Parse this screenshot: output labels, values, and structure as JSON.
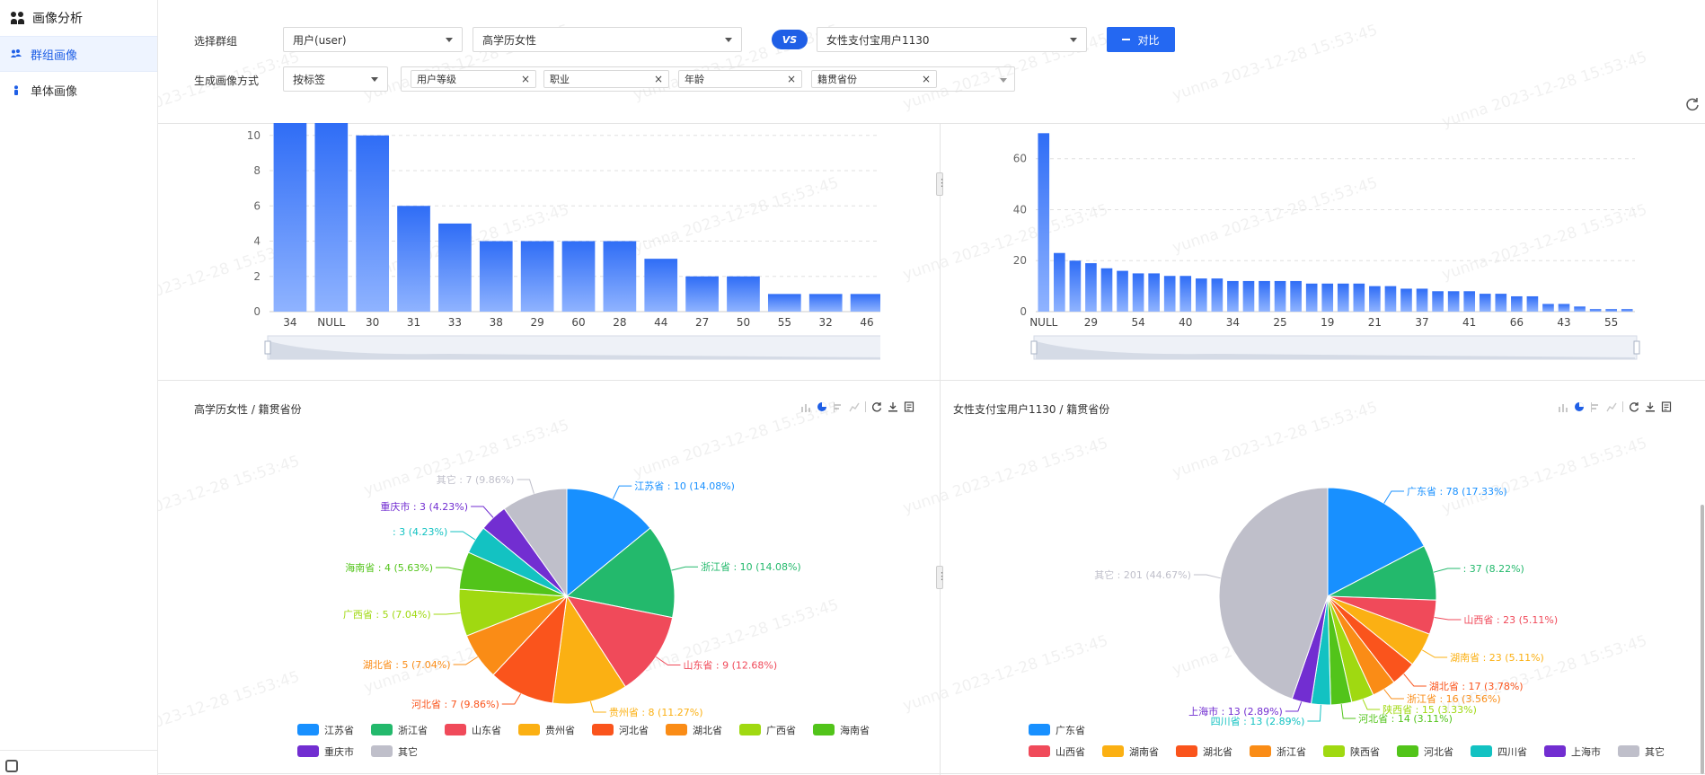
{
  "sidebar": {
    "title": "画像分析",
    "items": [
      {
        "label": "群组画像",
        "active": true
      },
      {
        "label": "单体画像",
        "active": false
      }
    ]
  },
  "controls": {
    "group_label": "选择群组",
    "group_type": "用户(user)",
    "group_a": "高学历女性",
    "vs": "VS",
    "group_b": "女性支付宝用户1130",
    "compare_button": "对比",
    "method_label": "生成画像方式",
    "method": "按标签",
    "tags": [
      "用户等级",
      "职业",
      "年龄",
      "籍贯省份"
    ]
  },
  "watermark": "yunna 2023-12-28 15:53:45",
  "colors": {
    "accent": "#2468f2",
    "bar_top": "#2f6df6",
    "bar_bottom": "#8fb3ff"
  },
  "chart_data": [
    {
      "type": "bar",
      "categories": [
        "34",
        "NULL",
        "30",
        "31",
        "33",
        "38",
        "29",
        "60",
        "28",
        "44",
        "27",
        "50",
        "55",
        "32",
        "46"
      ],
      "values": [
        11,
        11,
        10,
        6,
        5,
        4,
        4,
        4,
        4,
        3,
        2,
        2,
        1,
        1,
        1
      ],
      "yticks": [
        "0",
        "2",
        "4",
        "6",
        "8",
        "10"
      ],
      "ylim": [
        0,
        10.5
      ],
      "grid": true
    },
    {
      "type": "bar",
      "tick_labels": [
        "NULL",
        "29",
        "54",
        "40",
        "34",
        "25",
        "19",
        "21",
        "37",
        "41",
        "66",
        "43",
        "55"
      ],
      "tick_index": [
        0,
        3,
        6,
        9,
        12,
        15,
        18,
        21,
        24,
        27,
        30,
        33,
        36
      ],
      "values": [
        70,
        23,
        20,
        19,
        17,
        16,
        15,
        15,
        14,
        14,
        13,
        13,
        12,
        12,
        12,
        12,
        12,
        11,
        11,
        11,
        11,
        10,
        10,
        9,
        9,
        8,
        8,
        8,
        7,
        7,
        6,
        6,
        3,
        3,
        2,
        1,
        1,
        1
      ],
      "yticks": [
        "0",
        "20",
        "40",
        "60"
      ],
      "ylim": [
        0,
        68
      ],
      "grid": true
    },
    {
      "type": "pie",
      "title": "高学历女性 / 籍贯省份",
      "slices": [
        {
          "name": "江苏省",
          "value": 10,
          "pct": "14.08%",
          "color": "#1890ff",
          "label": "江苏省 : 10 (14.08%)"
        },
        {
          "name": "浙江省",
          "value": 10,
          "pct": "14.08%",
          "color": "#23b96c",
          "label": "浙江省 : 10 (14.08%)"
        },
        {
          "name": "山东省",
          "value": 9,
          "pct": "12.68%",
          "color": "#f04a5a",
          "label": "山东省 : 9 (12.68%)"
        },
        {
          "name": "贵州省",
          "value": 8,
          "pct": "11.27%",
          "color": "#fbb013",
          "label": "贵州省 : 8 (11.27%)"
        },
        {
          "name": "河北省",
          "value": 7,
          "pct": "9.86%",
          "color": "#fa541c",
          "label": "河北省 : 7 (9.86%)"
        },
        {
          "name": "湖北省",
          "value": 5,
          "pct": "7.04%",
          "color": "#fa8c16",
          "label": "湖北省 : 5 (7.04%)"
        },
        {
          "name": "广西省",
          "value": 5,
          "pct": "7.04%",
          "color": "#a0d911",
          "label": "广西省 : 5 (7.04%)"
        },
        {
          "name": "海南省",
          "value": 4,
          "pct": "5.63%",
          "color": "#52c41a",
          "label": "海南省 : 4 (5.63%)"
        },
        {
          "name": "",
          "value": 3,
          "pct": "4.23%",
          "color": "#13c2c2",
          "label": " : 3 (4.23%)"
        },
        {
          "name": "重庆市",
          "value": 3,
          "pct": "4.23%",
          "color": "#722ed1",
          "label": "重庆市 : 3 (4.23%)"
        },
        {
          "name": "其它",
          "value": 7,
          "pct": "9.86%",
          "color": "#bfbfca",
          "label": "其它 : 7 (9.86%)"
        }
      ],
      "legend": [
        "江苏省",
        "浙江省",
        "山东省",
        "贵州省",
        "河北省",
        "湖北省",
        "广西省",
        "海南省",
        "重庆市",
        "其它"
      ],
      "legend_position": "bottom"
    },
    {
      "type": "pie",
      "title": "女性支付宝用户1130 / 籍贯省份",
      "slices": [
        {
          "name": "广东省",
          "value": 78,
          "pct": "17.33%",
          "color": "#1890ff",
          "label": "广东省 : 78 (17.33%)"
        },
        {
          "name": "",
          "value": 37,
          "pct": "8.22%",
          "color": "#23b96c",
          "label": " : 37 (8.22%)"
        },
        {
          "name": "山西省",
          "value": 23,
          "pct": "5.11%",
          "color": "#f04a5a",
          "label": "山西省 : 23 (5.11%)"
        },
        {
          "name": "湖南省",
          "value": 23,
          "pct": "5.11%",
          "color": "#fbb013",
          "label": "湖南省 : 23 (5.11%)"
        },
        {
          "name": "湖北省",
          "value": 17,
          "pct": "3.78%",
          "color": "#fa541c",
          "label": "湖北省 : 17 (3.78%)"
        },
        {
          "name": "浙江省",
          "value": 16,
          "pct": "3.56%",
          "color": "#fa8c16",
          "label": "浙江省 : 16 (3.56%)"
        },
        {
          "name": "陕西省",
          "value": 15,
          "pct": "3.33%",
          "color": "#a0d911",
          "label": "陕西省 : 15 (3.33%)"
        },
        {
          "name": "河北省",
          "value": 14,
          "pct": "3.11%",
          "color": "#52c41a",
          "label": "河北省 : 14 (3.11%)"
        },
        {
          "name": "四川省",
          "value": 13,
          "pct": "2.89%",
          "color": "#13c2c2",
          "label": "四川省 : 13 (2.89%)"
        },
        {
          "name": "上海市",
          "value": 13,
          "pct": "2.89%",
          "color": "#722ed1",
          "label": "上海市 : 13 (2.89%)"
        },
        {
          "name": "其它",
          "value": 201,
          "pct": "44.67%",
          "color": "#bfbfca",
          "label": "其它 : 201 (44.67%)"
        }
      ],
      "legend": [
        "广东省",
        "山西省",
        "湖南省",
        "湖北省",
        "浙江省",
        "陕西省",
        "河北省",
        "四川省",
        "上海市",
        "其它"
      ],
      "legend_position": "bottom"
    }
  ]
}
